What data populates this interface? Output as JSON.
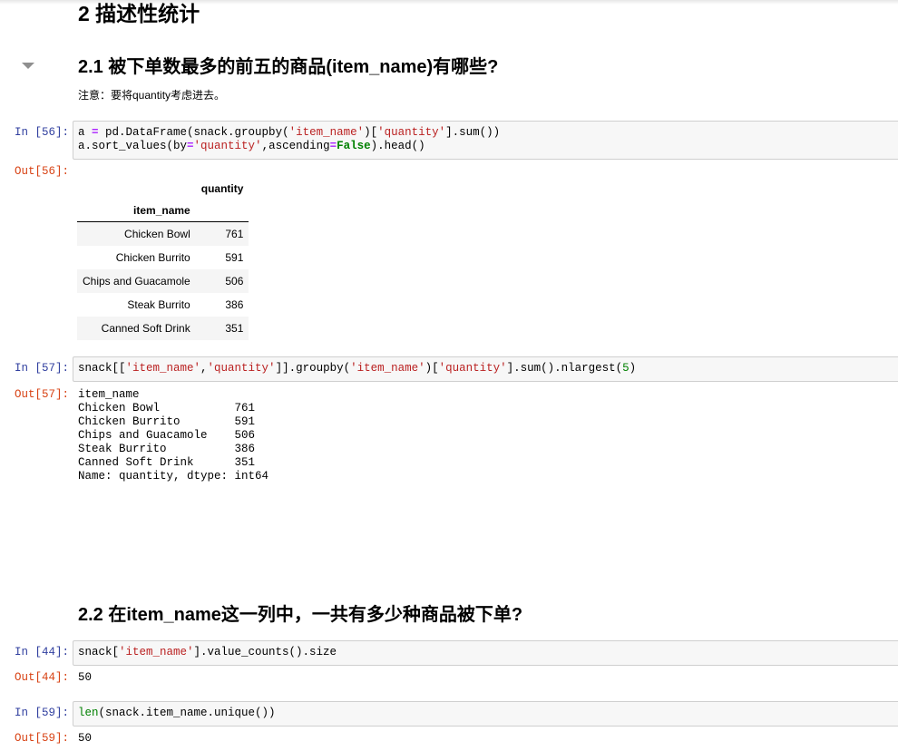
{
  "section_title": "2  描述性统计",
  "q1": {
    "title": "2.1  被下单数最多的前五的商品(item_name)有哪些?",
    "note": "注意：要将quantity考虑进去。"
  },
  "cell56": {
    "in_prompt": "In  [56]:",
    "out_prompt": "Out[56]:",
    "table": {
      "column_header": "quantity",
      "index_name": "item_name",
      "rows": [
        {
          "item": "Chicken Bowl",
          "quantity": "761"
        },
        {
          "item": "Chicken Burrito",
          "quantity": "591"
        },
        {
          "item": "Chips and Guacamole",
          "quantity": "506"
        },
        {
          "item": "Steak Burrito",
          "quantity": "386"
        },
        {
          "item": "Canned Soft Drink",
          "quantity": "351"
        }
      ]
    }
  },
  "cell57": {
    "in_prompt": "In  [57]:",
    "out_prompt": "Out[57]:",
    "output_lines": [
      "item_name",
      "Chicken Bowl           761",
      "Chicken Burrito        591",
      "Chips and Guacamole    506",
      "Steak Burrito          386",
      "Canned Soft Drink      351",
      "Name: quantity, dtype: int64"
    ]
  },
  "q2": {
    "title": "2.2  在item_name这一列中，一共有多少种商品被下单?"
  },
  "cell44": {
    "in_prompt": "In  [44]:",
    "out_prompt": "Out[44]:",
    "output": "50"
  },
  "cell59": {
    "in_prompt": "In  [59]:",
    "out_prompt": "Out[59]:",
    "output": "50"
  }
}
